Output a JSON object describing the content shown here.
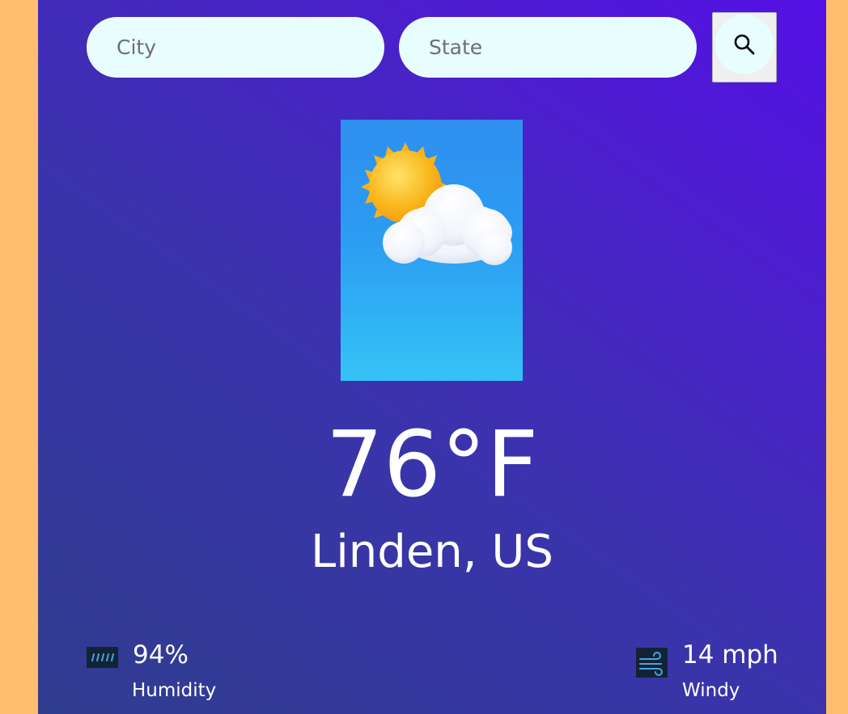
{
  "search": {
    "city_placeholder": "City",
    "state_placeholder": "State",
    "button_icon": "search-icon"
  },
  "weather": {
    "image_icon": "partly-cloudy-icon",
    "temperature": "76°F",
    "location": "Linden, US"
  },
  "stats": {
    "humidity": {
      "icon": "humidity-icon",
      "value": "94%",
      "label": "Humidity"
    },
    "wind": {
      "icon": "wind-icon",
      "value": "14 mph",
      "label": "Windy"
    }
  },
  "colors": {
    "page_background": "#ffbe6f",
    "card_gradient_start": "#2f3d8e",
    "card_gradient_end": "#5510e6",
    "input_background": "#e8fefe",
    "text": "#ffffff"
  }
}
